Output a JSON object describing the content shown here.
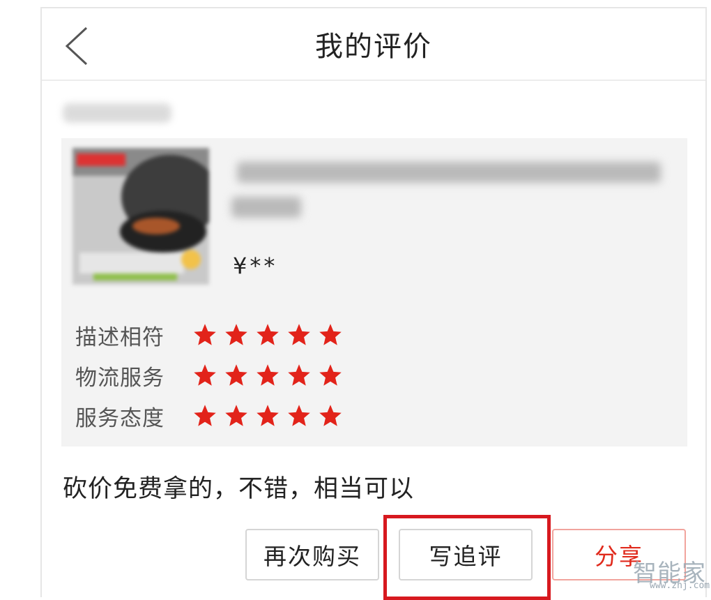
{
  "header": {
    "title": "我的评价",
    "back_icon": "chevron-left-icon"
  },
  "order": {
    "price": "¥**"
  },
  "ratings": [
    {
      "label": "描述相符",
      "stars": 5
    },
    {
      "label": "物流服务",
      "stars": 5
    },
    {
      "label": "服务态度",
      "stars": 5
    }
  ],
  "review_text": "砍价免费拿的，不错，相当可以",
  "actions": {
    "buy_again": "再次购买",
    "follow_up_review": "写追评",
    "share": "分享"
  },
  "watermark": {
    "text": "智能家",
    "url": "www.znj.com"
  },
  "colors": {
    "star": "#e2231a",
    "share_text": "#e02a1c",
    "highlight_box": "#d7191f",
    "card_background": "#f3f3f3"
  }
}
